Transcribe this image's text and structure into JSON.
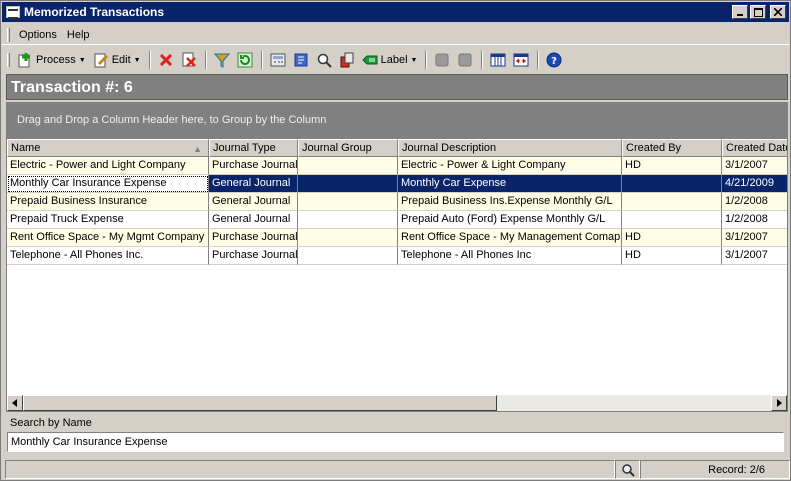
{
  "window": {
    "title": "Memorized Transactions"
  },
  "menu": {
    "options": "Options",
    "help": "Help"
  },
  "toolbar": {
    "process_label": "Process",
    "edit_label": "Edit",
    "label_label": "Label"
  },
  "header": {
    "transaction_label": "Transaction #: 6"
  },
  "group_hint": "Drag and Drop a Column Header here, to Group by the Column",
  "grid": {
    "columns": [
      "Name",
      "Journal Type",
      "Journal Group",
      "Journal Description",
      "Created By",
      "Created Date"
    ],
    "sorted_column": "Name",
    "rows": [
      {
        "name": "Electric - Power and Light Company",
        "type": "Purchase Journal",
        "group": "",
        "description": "Electric - Power & Light Company",
        "created_by": "HD",
        "created_date": "3/1/2007"
      },
      {
        "name": "Monthly Car Insurance Expense",
        "type": "General Journal",
        "group": "",
        "description": "Monthly Car Expense",
        "created_by": "",
        "created_date": "4/21/2009"
      },
      {
        "name": "Prepaid Business Insurance",
        "type": "General Journal",
        "group": "",
        "description": "Prepaid Business Ins.Expense Monthly G/L",
        "created_by": "",
        "created_date": "1/2/2008"
      },
      {
        "name": "Prepaid Truck Expense",
        "type": "General Journal",
        "group": "",
        "description": "Prepaid Auto (Ford) Expense Monthly G/L",
        "created_by": "",
        "created_date": "1/2/2008"
      },
      {
        "name": "Rent Office Space - My Mgmt Company",
        "type": "Purchase Journal",
        "group": "",
        "description": "Rent Office Space - My Management Comapny",
        "created_by": "HD",
        "created_date": "3/1/2007"
      },
      {
        "name": "Telephone - All Phones Inc.",
        "type": "Purchase Journal",
        "group": "",
        "description": "Telephone - All Phones Inc",
        "created_by": "HD",
        "created_date": "3/1/2007"
      }
    ],
    "selected_index": 1
  },
  "search": {
    "label": "Search by Name",
    "value": "Monthly Car Insurance Expense"
  },
  "status": {
    "record": "Record: 2/6"
  }
}
